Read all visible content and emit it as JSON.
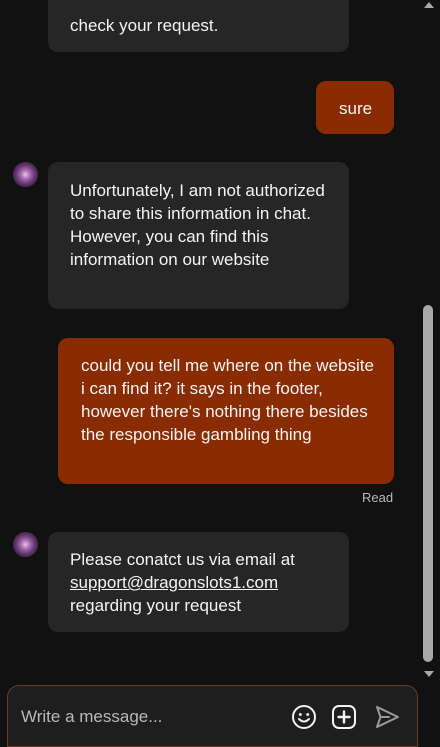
{
  "messages": [
    {
      "role": "agent",
      "text": "check your request."
    },
    {
      "role": "user",
      "text": "sure"
    },
    {
      "role": "agent",
      "text": "Unfortunately, I am not authorized to share this information in chat. However, you can find this information on our website"
    },
    {
      "role": "user",
      "text": "could you tell me where on the website i can find it? it says in the footer, however there's nothing there besides the responsible gambling thing",
      "status": "Read"
    },
    {
      "role": "agent",
      "text_before": "Please conatct us via email at",
      "link": "support@dragonslots1.com",
      "text_after": "regarding your request"
    }
  ],
  "composer": {
    "placeholder": "Write a message...",
    "icons": [
      "emoji-icon",
      "add-icon",
      "send-icon"
    ]
  },
  "colors": {
    "background": "#111111",
    "agent_bubble": "#262626",
    "user_bubble": "#8a2c02",
    "composer_border": "#6a3a22"
  }
}
